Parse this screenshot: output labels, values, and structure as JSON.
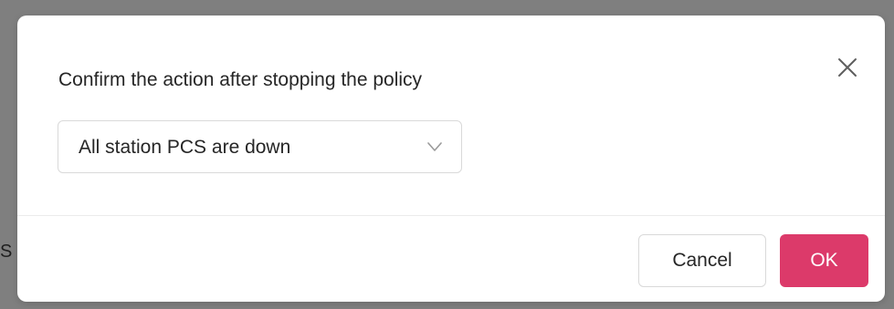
{
  "background": {
    "partial_text": "S"
  },
  "dialog": {
    "title": "Confirm the action after stopping the policy",
    "close_icon": "close-icon",
    "select": {
      "selected_value": "All station PCS are down",
      "icon": "chevron-down-icon"
    },
    "buttons": {
      "cancel_label": "Cancel",
      "ok_label": "OK"
    }
  },
  "colors": {
    "overlay": "#7f7f7f",
    "primary": "#dc3a6a",
    "border": "#d9d9d9",
    "text": "#262626"
  }
}
